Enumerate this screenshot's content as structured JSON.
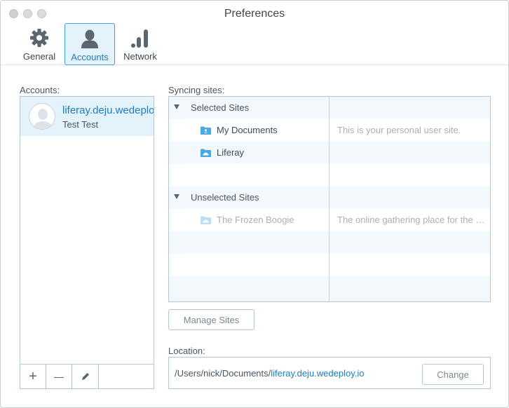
{
  "window": {
    "title": "Preferences"
  },
  "tabs": [
    {
      "label": "General",
      "icon": "gear-icon"
    },
    {
      "label": "Accounts",
      "icon": "user-icon",
      "selected": true
    },
    {
      "label": "Network",
      "icon": "signal-bars-icon"
    }
  ],
  "accounts": {
    "label": "Accounts:",
    "items": [
      {
        "name": "liferay.deju.wedeploy.io",
        "user": "Test Test",
        "icon": "avatar-placeholder-icon"
      }
    ],
    "toolbar": {
      "add": "+",
      "remove": "—",
      "edit_icon": "pencil-icon"
    }
  },
  "syncing": {
    "label": "Syncing sites:",
    "groups": [
      {
        "label": "Selected Sites",
        "sites": [
          {
            "name": "My Documents",
            "description": "This is your personal user site.",
            "icon": "user-folder-icon"
          },
          {
            "name": "Liferay",
            "description": "",
            "icon": "cloud-folder-icon"
          }
        ]
      },
      {
        "label": "Unselected Sites",
        "sites": [
          {
            "name": "The Frozen Boogie",
            "description": "The online gathering place for the Frozen Boogie community",
            "icon": "cloud-folder-icon"
          }
        ]
      }
    ],
    "manage_button": "Manage Sites"
  },
  "location": {
    "label": "Location:",
    "path_prefix": "/Users/nick/Documents/",
    "path_folder": "liferay.deju.wedeploy.io",
    "change_button": "Change"
  },
  "colors": {
    "accent": "#1b7cc3",
    "selection_bg": "#e4f2fb",
    "border": "#b4c6d4",
    "folder": "#4ba8e0"
  }
}
